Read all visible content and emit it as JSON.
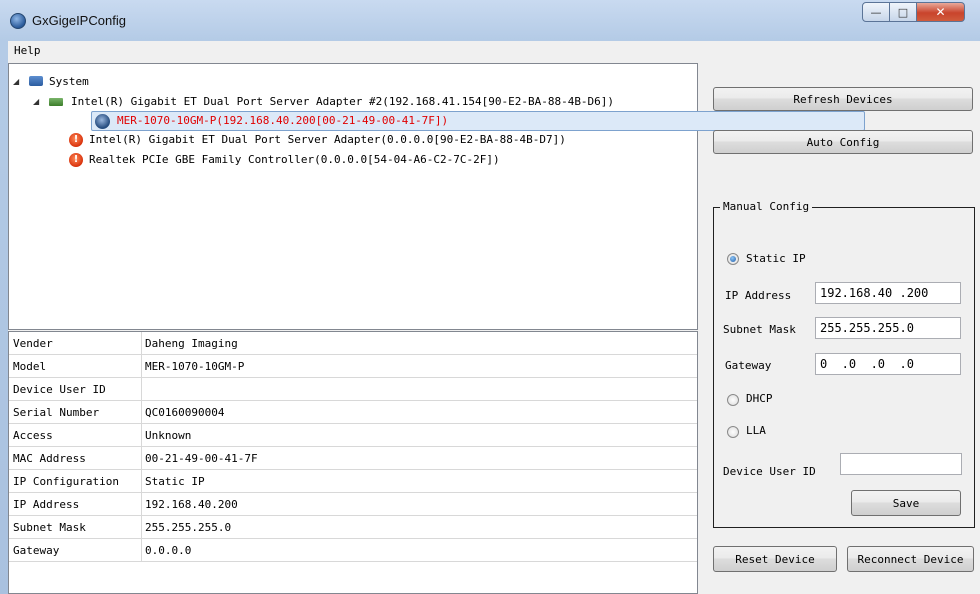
{
  "window": {
    "title": "GxGigeIPConfig"
  },
  "menu": {
    "help": "Help"
  },
  "tree": {
    "root": "System",
    "adapter1": "Intel(R) Gigabit ET Dual Port Server Adapter #2(192.168.41.154[90-E2-BA-88-4B-D6])",
    "camera": "MER-1070-10GM-P(192.168.40.200[00-21-49-00-41-7F])",
    "adapter2": "Intel(R) Gigabit ET Dual Port Server Adapter(0.0.0.0[90-E2-BA-88-4B-D7])",
    "adapter3": "Realtek PCIe GBE Family Controller(0.0.0.0[54-04-A6-C2-7C-2F])"
  },
  "properties": [
    {
      "key": "Vender",
      "value": "Daheng Imaging"
    },
    {
      "key": "Model",
      "value": "MER-1070-10GM-P"
    },
    {
      "key": "Device User ID",
      "value": ""
    },
    {
      "key": "Serial Number",
      "value": "QC0160090004"
    },
    {
      "key": "Access",
      "value": "Unknown"
    },
    {
      "key": "MAC Address",
      "value": "00-21-49-00-41-7F"
    },
    {
      "key": "IP Configuration",
      "value": "Static IP"
    },
    {
      "key": "IP Address",
      "value": "192.168.40.200"
    },
    {
      "key": "Subnet Mask",
      "value": "255.255.255.0"
    },
    {
      "key": "Gateway",
      "value": "0.0.0.0"
    }
  ],
  "panel": {
    "refresh": "Refresh Devices",
    "auto_config": "Auto Config",
    "group_title": "Manual Config",
    "static_ip": "Static IP",
    "ip_label": "IP Address",
    "ip_value": "192.168.40 .200",
    "mask_label": "Subnet Mask",
    "mask_value": "255.255.255.0",
    "gateway_label": "Gateway",
    "gateway_value": "0  .0  .0  .0",
    "dhcp": "DHCP",
    "lla": "LLA",
    "user_id_label": "Device User ID",
    "user_id_value": "",
    "save": "Save",
    "reset": "Reset Device",
    "reconnect": "Reconnect Device"
  },
  "colors": {
    "selected_text": "#e00000",
    "selection_border": "#7da2ce",
    "selection_fill": "#dce9f8"
  }
}
